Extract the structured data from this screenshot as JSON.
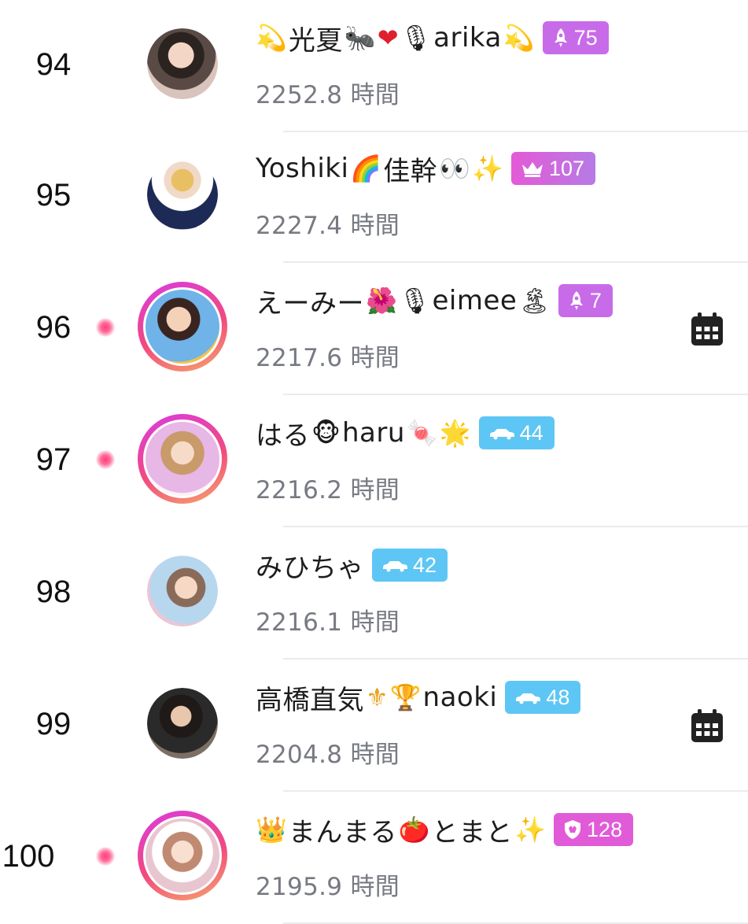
{
  "ranking": {
    "hours_unit": "時間",
    "rows": [
      {
        "rank": "94",
        "name": "光夏",
        "name2": "arika",
        "hours": "2252.8",
        "badge_value": "75",
        "badge_icon": "rocket-icon",
        "badge_color": "#c86be8",
        "live": false,
        "calendar": false
      },
      {
        "rank": "95",
        "name": "Yoshiki",
        "name2": "佳幹",
        "hours": "2227.4",
        "badge_value": "107",
        "badge_icon": "crown-icon",
        "badge_color": "#e45ad6",
        "live": false,
        "calendar": false
      },
      {
        "rank": "96",
        "name": "えーみー",
        "name2": "eimee",
        "hours": "2217.6",
        "badge_value": "7",
        "badge_icon": "rocket-icon",
        "badge_color": "#c86be8",
        "live": true,
        "calendar": true
      },
      {
        "rank": "97",
        "name": "はる",
        "name2": "haru",
        "hours": "2216.2",
        "badge_value": "44",
        "badge_icon": "car-icon",
        "badge_color": "#5ec6f4",
        "live": true,
        "calendar": false
      },
      {
        "rank": "98",
        "name": "みひちゃ",
        "name2": "",
        "hours": "2216.1",
        "badge_value": "42",
        "badge_icon": "car-icon",
        "badge_color": "#5ec6f4",
        "live": false,
        "calendar": false
      },
      {
        "rank": "99",
        "name": "高橋直気",
        "name2": "naoki",
        "hours": "2204.8",
        "badge_value": "48",
        "badge_icon": "car-icon",
        "badge_color": "#5ec6f4",
        "live": false,
        "calendar": true
      },
      {
        "rank": "100",
        "name": "まんまる",
        "name2": "とまと",
        "hours": "2195.9",
        "badge_value": "128",
        "badge_icon": "shield-icon",
        "badge_color": "#e15bd8",
        "live": true,
        "calendar": false
      }
    ]
  }
}
